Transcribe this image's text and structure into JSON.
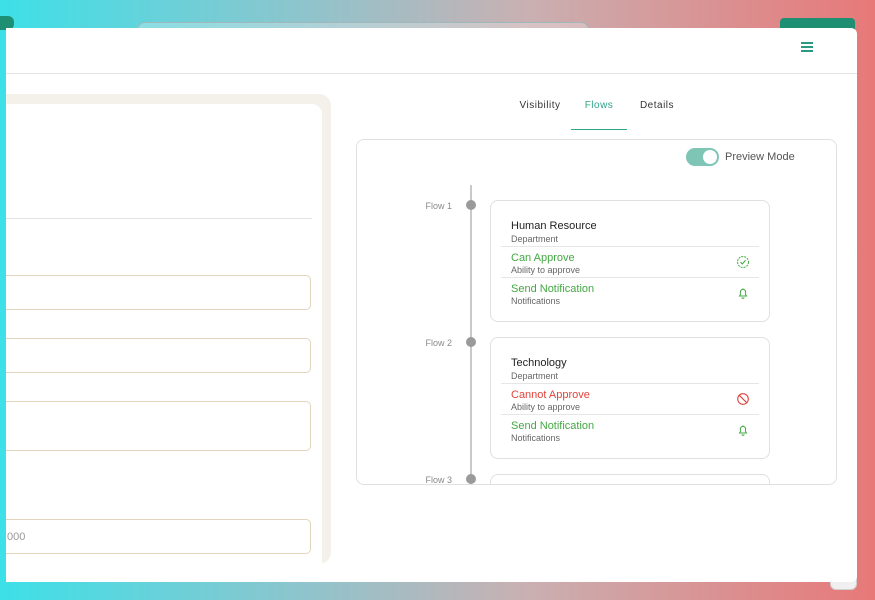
{
  "header": {
    "menu_icon": "hamburger-menu-icon"
  },
  "form": {
    "last_field_value": "000"
  },
  "tabs": [
    {
      "label": "Visibility",
      "active": false
    },
    {
      "label": "Flows",
      "active": true
    },
    {
      "label": "Details",
      "active": false
    }
  ],
  "preview": {
    "label": "Preview Mode",
    "enabled": true
  },
  "flows": [
    {
      "label": "Flow 1",
      "title": "Human Resource",
      "subtitle": "Department",
      "rows": [
        {
          "title": "Can Approve",
          "subtitle": "Ability to approve",
          "status": "green",
          "icon": "check-circle-icon"
        },
        {
          "title": "Send Notification",
          "subtitle": "Notifications",
          "status": "green",
          "icon": "bell-icon"
        }
      ]
    },
    {
      "label": "Flow 2",
      "title": "Technology",
      "subtitle": "Department",
      "rows": [
        {
          "title": "Cannot Approve",
          "subtitle": "Ability to approve",
          "status": "red",
          "icon": "prohibited-icon"
        },
        {
          "title": "Send Notification",
          "subtitle": "Notifications",
          "status": "green",
          "icon": "bell-icon"
        }
      ]
    },
    {
      "label": "Flow 3"
    }
  ],
  "colors": {
    "accent": "#2ea58a",
    "success": "#43a842",
    "danger": "#e0443c"
  }
}
